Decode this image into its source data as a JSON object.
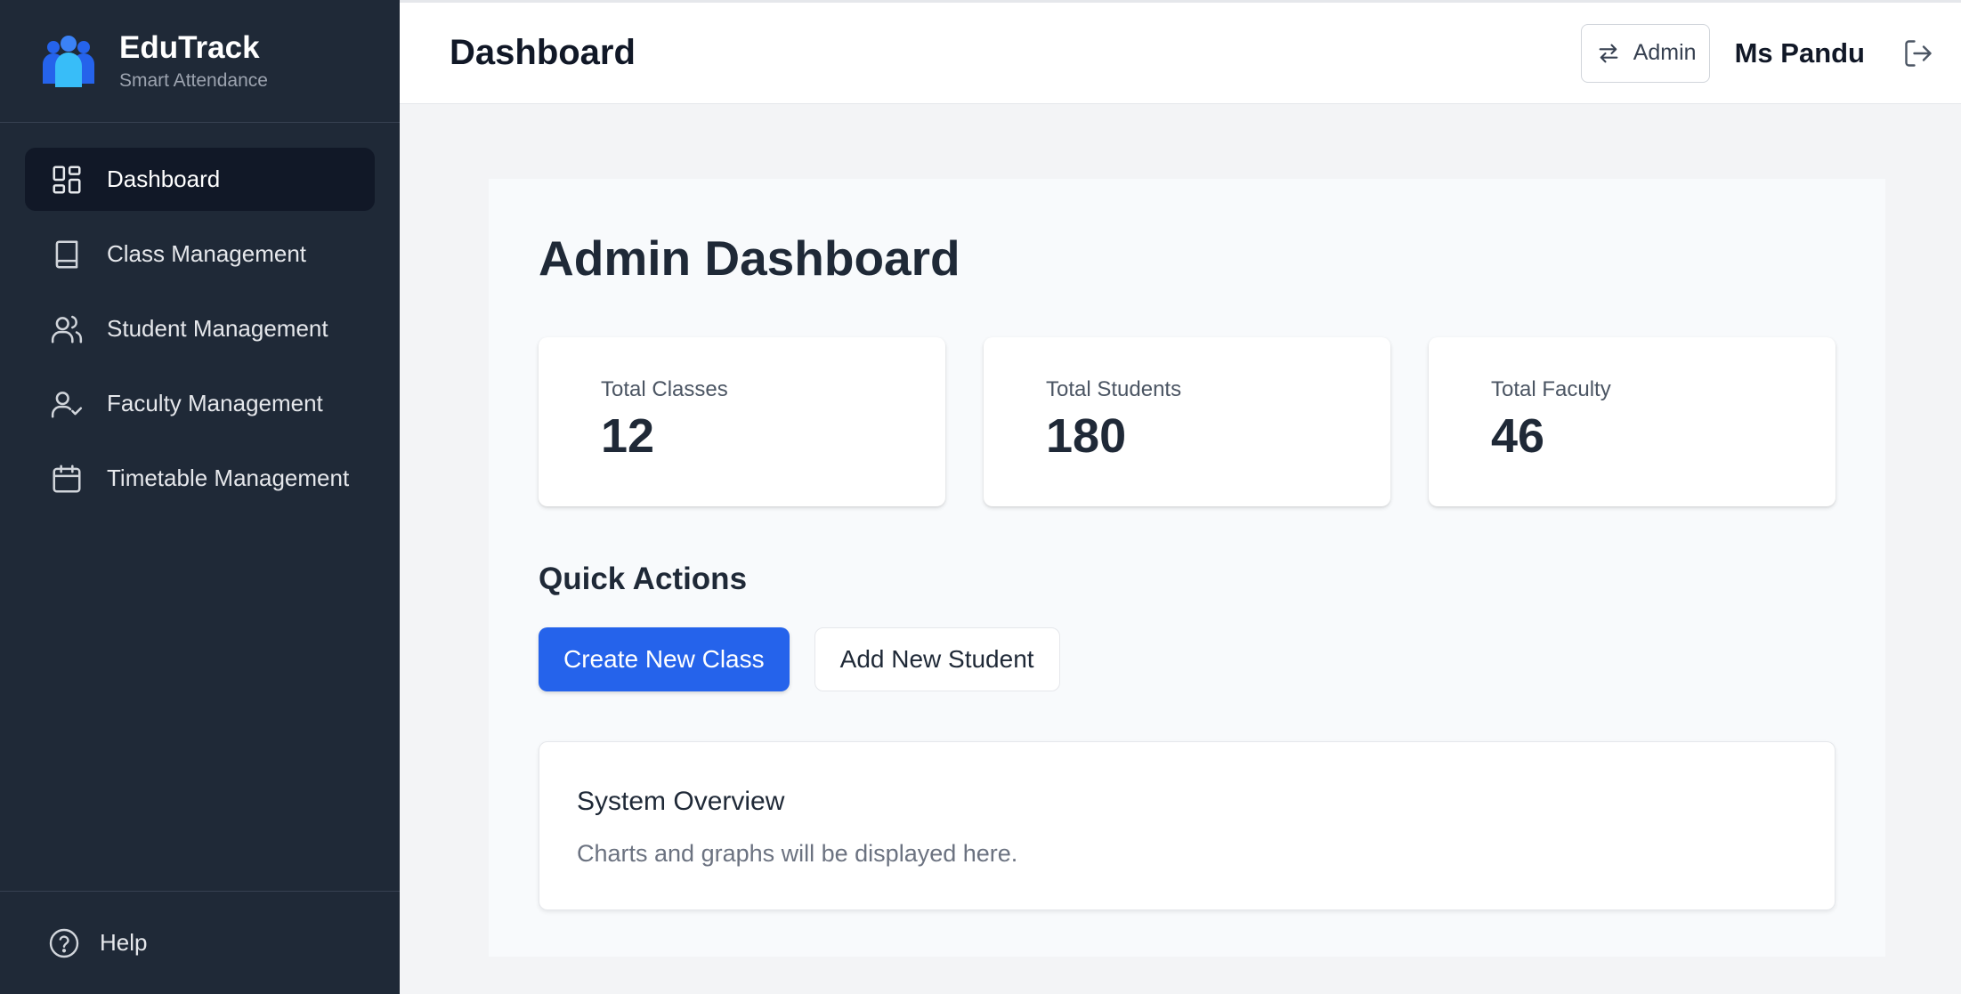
{
  "brand": {
    "name": "EduTrack",
    "subtitle": "Smart Attendance"
  },
  "sidebar": {
    "items": [
      {
        "label": "Dashboard",
        "icon": "dashboard-grid-icon",
        "active": true
      },
      {
        "label": "Class Management",
        "icon": "book-icon"
      },
      {
        "label": "Student Management",
        "icon": "users-icon"
      },
      {
        "label": "Faculty Management",
        "icon": "user-check-icon"
      },
      {
        "label": "Timetable Management",
        "icon": "calendar-icon"
      }
    ],
    "help_label": "Help"
  },
  "header": {
    "title": "Dashboard",
    "role_label": "Admin",
    "user_name": "Ms Pandu"
  },
  "main": {
    "heading": "Admin Dashboard",
    "stats": [
      {
        "label": "Total Classes",
        "value": "12"
      },
      {
        "label": "Total Students",
        "value": "180"
      },
      {
        "label": "Total Faculty",
        "value": "46"
      }
    ],
    "quick_actions": {
      "title": "Quick Actions",
      "create_class": "Create New Class",
      "add_student": "Add New Student"
    },
    "overview": {
      "title": "System Overview",
      "text": "Charts and graphs will be displayed here."
    }
  },
  "colors": {
    "sidebar_bg": "#1f2937",
    "active_bg": "#111827",
    "primary": "#2563eb",
    "logo": "#3b82f6"
  }
}
